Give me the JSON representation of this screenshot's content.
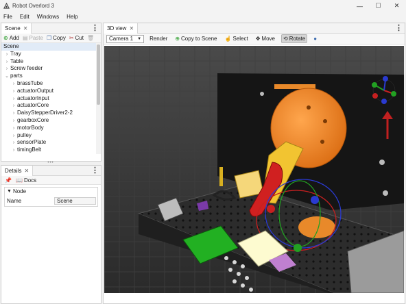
{
  "window": {
    "title": "Robot Overlord 3",
    "min": "—",
    "max": "☐",
    "close": "✕"
  },
  "menu": [
    "File",
    "Edit",
    "Windows",
    "Help"
  ],
  "scene_panel": {
    "tab_label": "Scene",
    "toolbar": {
      "add": "Add",
      "paste": "Paste",
      "copy": "Copy",
      "cut": "Cut"
    },
    "tree": {
      "root": "Scene",
      "items": [
        {
          "label": "Tray",
          "depth": 1
        },
        {
          "label": "Table",
          "depth": 1
        },
        {
          "label": "Screw feeder",
          "depth": 1
        },
        {
          "label": "parts",
          "depth": 1,
          "expanded": true
        },
        {
          "label": "brassTube",
          "depth": 2
        },
        {
          "label": "actuatorOutput",
          "depth": 2
        },
        {
          "label": "actuatorInput",
          "depth": 2
        },
        {
          "label": "actuatorCore",
          "depth": 2
        },
        {
          "label": "DaisyStepperDriver2-2",
          "depth": 2
        },
        {
          "label": "gearboxCore",
          "depth": 2
        },
        {
          "label": "motorBody",
          "depth": 2
        },
        {
          "label": "pulley",
          "depth": 2
        },
        {
          "label": "sensorPlate",
          "depth": 2
        },
        {
          "label": "timingBelt",
          "depth": 2
        }
      ]
    }
  },
  "details_panel": {
    "tab_label": "Details",
    "docs_label": "Docs",
    "group_label": "Node",
    "props": [
      {
        "label": "Name",
        "value": "Scene"
      }
    ]
  },
  "view_panel": {
    "tab_label": "3D view",
    "camera": "Camera 1",
    "buttons": {
      "render": "Render",
      "copy_to_scene": "Copy to Scene",
      "select": "Select",
      "move": "Move",
      "rotate": "Rotate"
    }
  },
  "colors": {
    "accent_orange": "#e8892a",
    "selection_red": "#c62020",
    "pcb_green": "#22b022",
    "tree_highlight": "#e1ebf7"
  }
}
